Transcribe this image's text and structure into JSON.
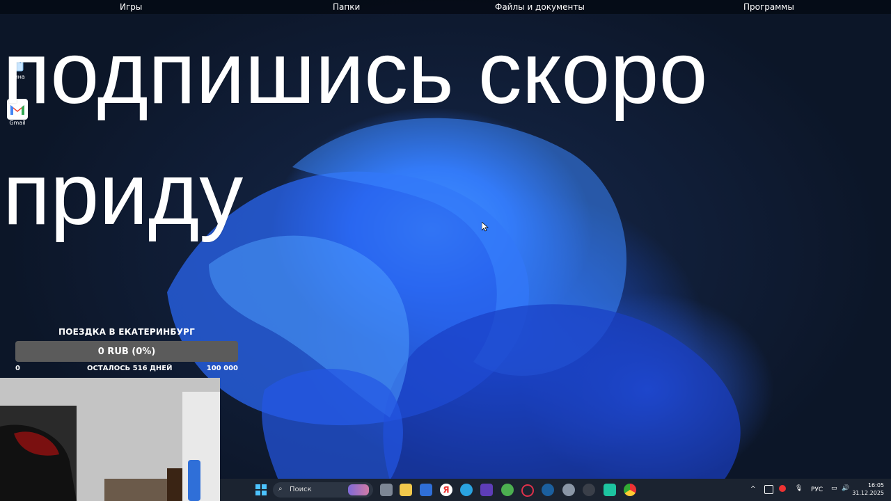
{
  "top_bar": {
    "items": [
      "Игры",
      "Папки",
      "Файлы и документы",
      "Программы"
    ]
  },
  "overlay": {
    "line1": "подпишись скоро",
    "line2": "приду"
  },
  "desktop": {
    "icons": [
      {
        "label": "зина",
        "icon": "recycle-bin-icon"
      },
      {
        "label": "Gmail",
        "icon": "gmail-icon"
      }
    ]
  },
  "goal_widget": {
    "title": "ПОЕЗДКА В ЕКАТЕРИНБУРГ",
    "progress_text": "0 RUB (0%)",
    "progress_fraction": 0,
    "min_label": "0",
    "remaining": "ОСТАЛОСЬ 516 ДНЕЙ",
    "max_label": "100 000"
  },
  "taskbar": {
    "search_placeholder": "Поиск",
    "language": "РУС",
    "time": "16:05",
    "date": "31.12.2025",
    "pinned_icons": [
      "file-explorer-icon",
      "yandex-icon",
      "telegram-icon",
      "app-icon",
      "app-icon",
      "opera-icon",
      "steam-icon",
      "settings-icon",
      "app-icon",
      "app-icon",
      "chrome-icon"
    ]
  },
  "colors": {
    "topbar_bg": "#050a14",
    "taskbar_bg": "#1b2330",
    "goal_bar_bg": "#5b5b5b"
  }
}
